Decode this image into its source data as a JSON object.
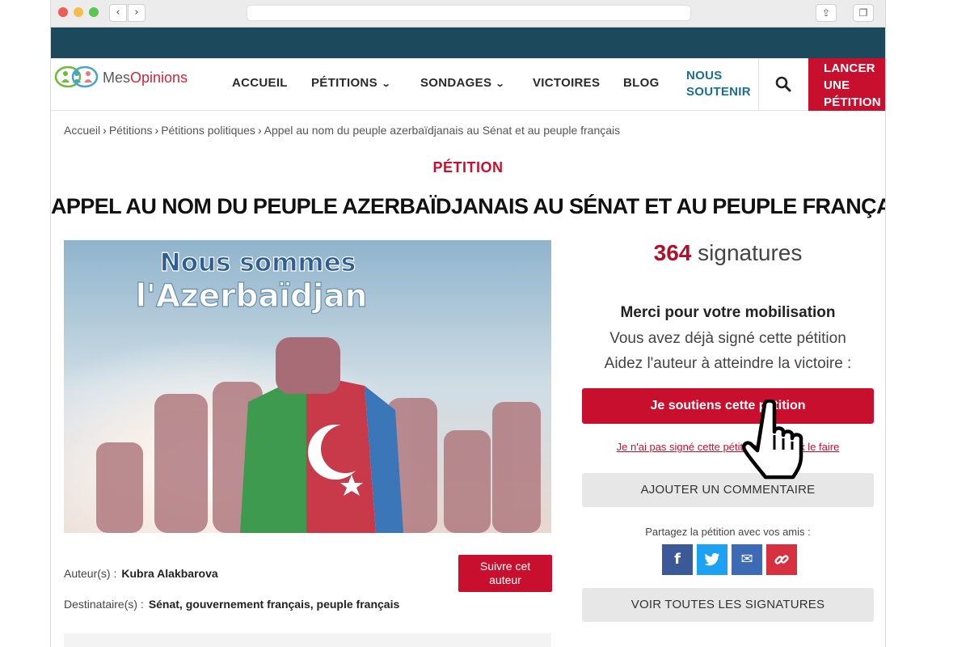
{
  "browser": {
    "back": "‹",
    "forward": "›"
  },
  "brand": {
    "logo_prefix": "Mes",
    "logo_suffix": "Opinions"
  },
  "nav": {
    "items": [
      {
        "label": "ACCUEIL"
      },
      {
        "label": "PÉTITIONS"
      },
      {
        "label": "SONDAGES"
      },
      {
        "label": "VICTOIRES"
      },
      {
        "label": "BLOG"
      }
    ],
    "support_line1": "NOUS",
    "support_line2": "SOUTENIR",
    "launch_line1": "LANCER",
    "launch_line2": "UNE",
    "launch_line3": "PÉTITION"
  },
  "breadcrumb": [
    "Accueil",
    "Pétitions",
    "Pétitions politiques",
    "Appel au nom du peuple azerbaïdjanais au Sénat et au peuple français"
  ],
  "petition": {
    "kicker": "PÉTITION",
    "title": "APPEL AU NOM DU PEUPLE AZERBAÏDJANAIS AU SÉNAT ET AU PEUPLE FRANÇAIS",
    "image_text_line1": "Nous sommes",
    "image_text_line2": "l'Azerbaïdjan",
    "author_label": "Auteur(s) :",
    "author_name": "Kubra Alakbarova",
    "recipient_label": "Destinataire(s) :",
    "recipient_value": "Sénat, gouvernement français, peuple français",
    "follow_line1": "Suivre cet",
    "follow_line2": "auteur"
  },
  "signatures": {
    "count": "364",
    "label": "signatures"
  },
  "sidebar": {
    "thanks_title": "Merci pour votre mobilisation",
    "thanks_line1": "Vous avez déjà signé cette pétition",
    "thanks_line2": "Aidez l'auteur à atteindre la victoire :",
    "support_button": "Je soutiens cette pétition",
    "not_signed_link": "Je n'ai pas signé cette pétition et je veux le faire",
    "comment_button": "AJOUTER UN COMMENTAIRE",
    "share_label": "Partagez la pétition avec vos amis :",
    "all_signatures_button": "VOIR TOUTES LES SIGNATURES"
  },
  "share": [
    {
      "icon": "facebook-icon",
      "glyph": "f",
      "color": "#3b5998"
    },
    {
      "icon": "twitter-icon",
      "glyph": "🐦",
      "color": "#1da1f2"
    },
    {
      "icon": "email-icon",
      "glyph": "✉",
      "color": "#3d6ab5"
    },
    {
      "icon": "link-icon",
      "glyph": "🔗",
      "color": "#d7303f"
    }
  ],
  "colors": {
    "brand_red": "#c8102e",
    "top_band": "#1c4a5c",
    "support_blue": "#1c6e8f"
  }
}
